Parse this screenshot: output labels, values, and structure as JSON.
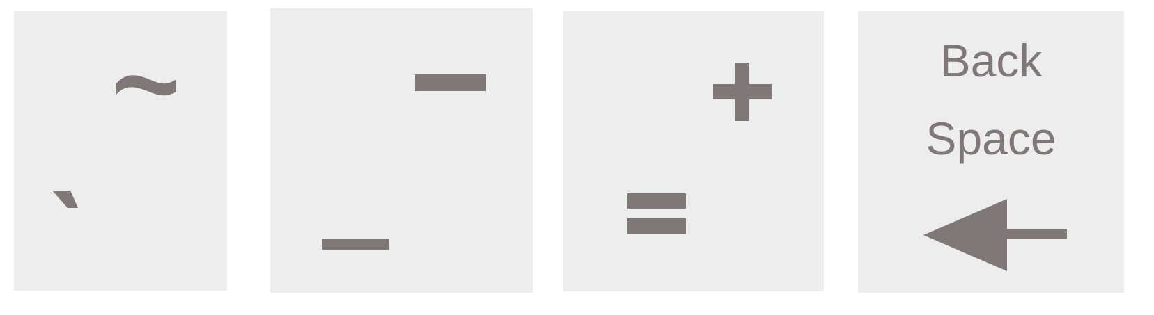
{
  "colors": {
    "key_background": "#ededed",
    "glyph": "#807877",
    "page_background": "#ffffff"
  },
  "keys": [
    {
      "id": "backtick-tilde",
      "shift_char": "~",
      "base_char": "`",
      "shift_icon": "tilde-icon",
      "base_icon": "grave-accent-icon"
    },
    {
      "id": "minus-underscore",
      "shift_char": "-",
      "base_char": "_",
      "shift_icon": "minus-icon",
      "base_icon": "underscore-icon"
    },
    {
      "id": "equals-plus",
      "shift_char": "+",
      "base_char": "=",
      "shift_icon": "plus-icon",
      "base_icon": "equals-icon"
    },
    {
      "id": "backspace",
      "label_line1": "Back",
      "label_line2": "Space",
      "icon": "left-arrow-icon"
    }
  ]
}
